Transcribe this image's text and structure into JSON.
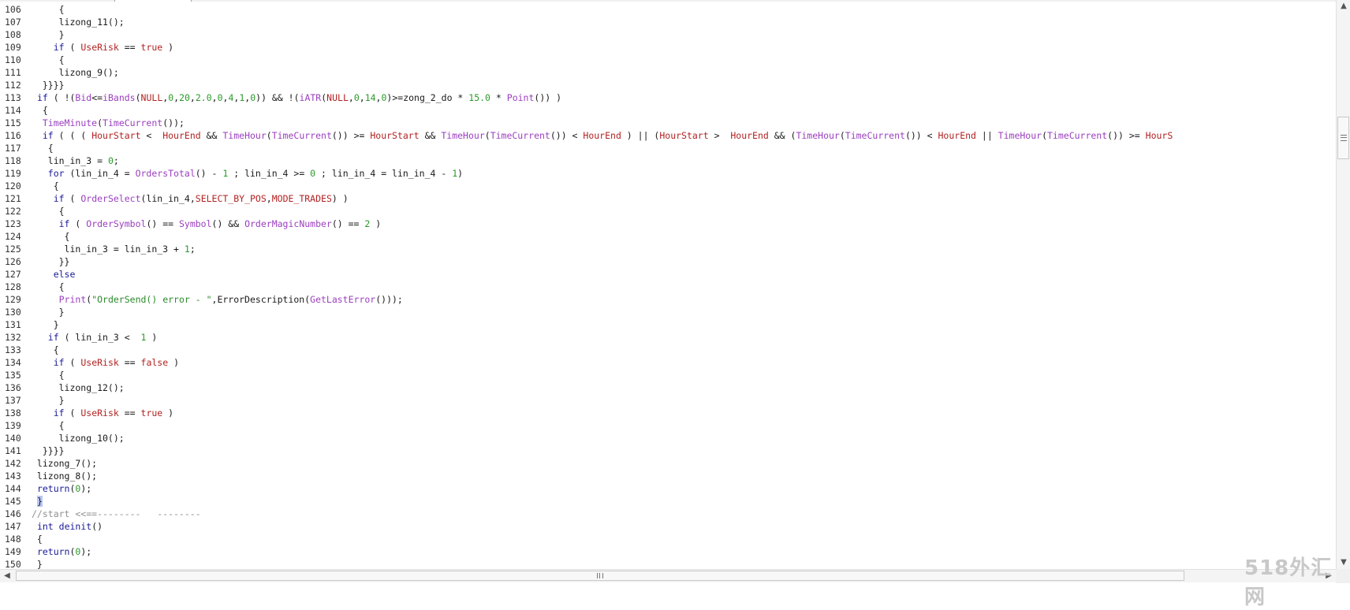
{
  "editor": {
    "lines": [
      {
        "n": "106",
        "html": "     {"
      },
      {
        "n": "107",
        "html": "     lizong_11();"
      },
      {
        "n": "108",
        "html": "     }"
      },
      {
        "n": "109",
        "html": "    <span class='kw'>if</span> ( <span class='cst'>UseRisk</span> == <span class='cst'>true</span> )"
      },
      {
        "n": "110",
        "html": "     {"
      },
      {
        "n": "111",
        "html": "     lizong_9();"
      },
      {
        "n": "112",
        "html": "  }}}}"
      },
      {
        "n": "113",
        "html": " <span class='kw'>if</span> ( !(<span class='fn'>Bid</span>&lt;=<span class='fn'>iBands</span>(<span class='cst'>NULL</span>,<span class='num'>0</span>,<span class='num'>20</span>,<span class='num'>2.0</span>,<span class='num'>0</span>,<span class='num'>4</span>,<span class='num'>1</span>,<span class='num'>0</span>)) &amp;&amp; !(<span class='fn'>iATR</span>(<span class='cst'>NULL</span>,<span class='num'>0</span>,<span class='num'>14</span>,<span class='num'>0</span>)&gt;=zong_2_do * <span class='num'>15.0</span> * <span class='fn'>Point</span>()) )"
      },
      {
        "n": "114",
        "html": "  {"
      },
      {
        "n": "115",
        "html": "  <span class='fn'>TimeMinute</span>(<span class='fn'>TimeCurrent</span>());"
      },
      {
        "n": "116",
        "html": "  <span class='kw'>if</span> ( ( ( <span class='cst'>HourStart</span> &lt;  <span class='cst'>HourEnd</span> &amp;&amp; <span class='fn'>TimeHour</span>(<span class='fn'>TimeCurrent</span>()) &gt;= <span class='cst'>HourStart</span> &amp;&amp; <span class='fn'>TimeHour</span>(<span class='fn'>TimeCurrent</span>()) &lt; <span class='cst'>HourEnd</span> ) || (<span class='cst'>HourStart</span> &gt;  <span class='cst'>HourEnd</span> &amp;&amp; (<span class='fn'>TimeHour</span>(<span class='fn'>TimeCurrent</span>()) &lt; <span class='cst'>HourEnd</span> || <span class='fn'>TimeHour</span>(<span class='fn'>TimeCurrent</span>()) &gt;= <span class='cst'>HourS</span>"
      },
      {
        "n": "117",
        "html": "   {"
      },
      {
        "n": "118",
        "html": "   lin_in_3 = <span class='num'>0</span>;"
      },
      {
        "n": "119",
        "html": "   <span class='kw'>for</span> (lin_in_4 = <span class='fn'>OrdersTotal</span>() - <span class='num'>1</span> ; lin_in_4 &gt;= <span class='num'>0</span> ; lin_in_4 = lin_in_4 - <span class='num'>1</span>)"
      },
      {
        "n": "120",
        "html": "    {"
      },
      {
        "n": "121",
        "html": "    <span class='kw'>if</span> ( <span class='fn'>OrderSelect</span>(lin_in_4,<span class='cst'>SELECT_BY_POS</span>,<span class='cst'>MODE_TRADES</span>) )"
      },
      {
        "n": "122",
        "html": "     {"
      },
      {
        "n": "123",
        "html": "     <span class='kw'>if</span> ( <span class='fn'>OrderSymbol</span>() == <span class='fn'>Symbol</span>() &amp;&amp; <span class='fn'>OrderMagicNumber</span>() == <span class='num'>2</span> )"
      },
      {
        "n": "124",
        "html": "      {"
      },
      {
        "n": "125",
        "html": "      lin_in_3 = lin_in_3 + <span class='num'>1</span>;"
      },
      {
        "n": "126",
        "html": "     }}"
      },
      {
        "n": "127",
        "html": "    <span class='kw'>else</span>"
      },
      {
        "n": "128",
        "html": "     {"
      },
      {
        "n": "129",
        "html": "     <span class='fn'>Print</span>(<span class='str'>\"OrderSend() error - \"</span>,ErrorDescription(<span class='fn'>GetLastError</span>()));"
      },
      {
        "n": "130",
        "html": "     }"
      },
      {
        "n": "131",
        "html": "    }"
      },
      {
        "n": "132",
        "html": "   <span class='kw'>if</span> ( lin_in_3 &lt;  <span class='num'>1</span> )"
      },
      {
        "n": "133",
        "html": "    {"
      },
      {
        "n": "134",
        "html": "    <span class='kw'>if</span> ( <span class='cst'>UseRisk</span> == <span class='cst'>false</span> )"
      },
      {
        "n": "135",
        "html": "     {"
      },
      {
        "n": "136",
        "html": "     lizong_12();"
      },
      {
        "n": "137",
        "html": "     }"
      },
      {
        "n": "138",
        "html": "    <span class='kw'>if</span> ( <span class='cst'>UseRisk</span> == <span class='cst'>true</span> )"
      },
      {
        "n": "139",
        "html": "     {"
      },
      {
        "n": "140",
        "html": "     lizong_10();"
      },
      {
        "n": "141",
        "html": "  }}}}"
      },
      {
        "n": "142",
        "html": " lizong_7();"
      },
      {
        "n": "143",
        "html": " lizong_8();"
      },
      {
        "n": "144",
        "html": " <span class='kw'>return</span>(<span class='num'>0</span>);"
      },
      {
        "n": "145",
        "html": " <span class='sel'>}</span>"
      },
      {
        "n": "146",
        "html": "<span class='cmt'>//start &lt;&lt;==--------   --------</span>"
      },
      {
        "n": "147",
        "html": " <span class='kw'>int</span> <span class='kw'>deinit</span>()"
      },
      {
        "n": "148",
        "html": " {"
      },
      {
        "n": "149",
        "html": " <span class='kw'>return</span>(<span class='num'>0</span>);"
      },
      {
        "n": "150",
        "html": " }"
      }
    ]
  },
  "scrollbars": {
    "up_arrow": "▲",
    "down_arrow": "▼",
    "left_arrow": "◀",
    "right_arrow": "▶"
  },
  "watermark": "518外汇网"
}
